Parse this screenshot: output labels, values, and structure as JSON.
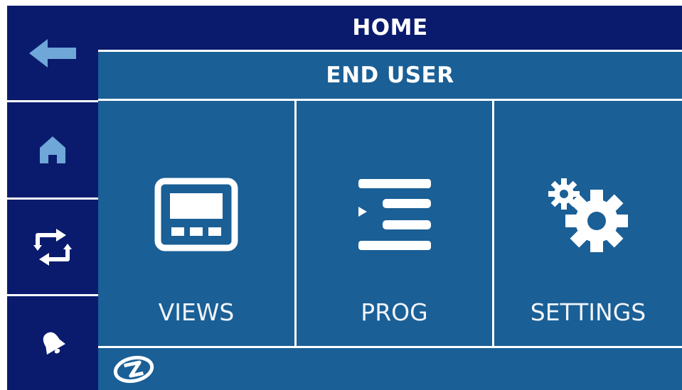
{
  "header": {
    "title": "HOME",
    "subtitle": "END USER"
  },
  "sidebar": {
    "buttons": [
      {
        "name": "back",
        "icon": "arrow-left-icon"
      },
      {
        "name": "home",
        "icon": "home-icon"
      },
      {
        "name": "sync",
        "icon": "sync-icon"
      },
      {
        "name": "alarm",
        "icon": "bell-icon"
      }
    ]
  },
  "tiles": [
    {
      "label": "VIEWS",
      "icon": "display-icon"
    },
    {
      "label": "PROG",
      "icon": "program-list-icon"
    },
    {
      "label": "SETTINGS",
      "icon": "gears-icon"
    }
  ],
  "colors": {
    "dark_navy": "#0a1b6e",
    "panel_blue": "#1a5f96",
    "icon_light_blue": "#6fa7d8"
  }
}
